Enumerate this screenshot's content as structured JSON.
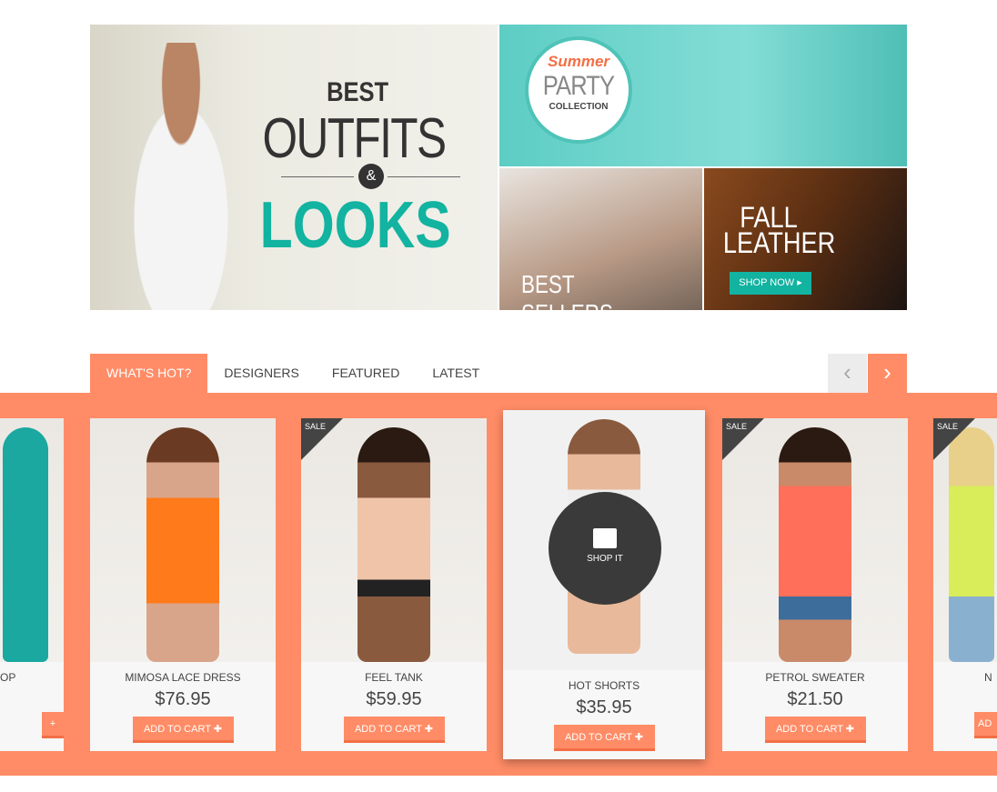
{
  "banners": {
    "main": {
      "line1": "BEST",
      "line2": "OUTFITS",
      "amp": "&",
      "line3": "LOOKS"
    },
    "party": {
      "script": "Summer",
      "title": "PARTY",
      "sub": "COLLECTION"
    },
    "sellers": {
      "label": "BEST SELLERS ›"
    },
    "leather": {
      "line1": "FALL",
      "line2": "LEATHER",
      "button": "SHOP NOW ▸"
    }
  },
  "tabs": [
    {
      "label": "WHAT'S HOT?"
    },
    {
      "label": "DESIGNERS"
    },
    {
      "label": "FEATURED"
    },
    {
      "label": "LATEST"
    }
  ],
  "nav": {
    "prev": "‹",
    "next": "›"
  },
  "products": [
    {
      "name": "OP",
      "price": "",
      "cart": "+"
    },
    {
      "name": "MIMOSA LACE DRESS",
      "price": "$76.95",
      "cart": "ADD TO CART  ✚"
    },
    {
      "name": "FEEL TANK",
      "price": "$59.95",
      "cart": "ADD TO CART  ✚",
      "badge": "SALE"
    },
    {
      "name": "HOT SHORTS",
      "price": "$35.95",
      "cart": "ADD TO CART  ✚",
      "overlay": "SHOP IT"
    },
    {
      "name": "PETROL SWEATER",
      "price": "$21.50",
      "cart": "ADD TO CART  ✚",
      "badge": "SALE"
    },
    {
      "name": "N",
      "price": "",
      "cart": "AD",
      "badge": "SALE"
    }
  ],
  "colors": {
    "accent": "#ff8c66",
    "teal": "#12b3a0"
  }
}
